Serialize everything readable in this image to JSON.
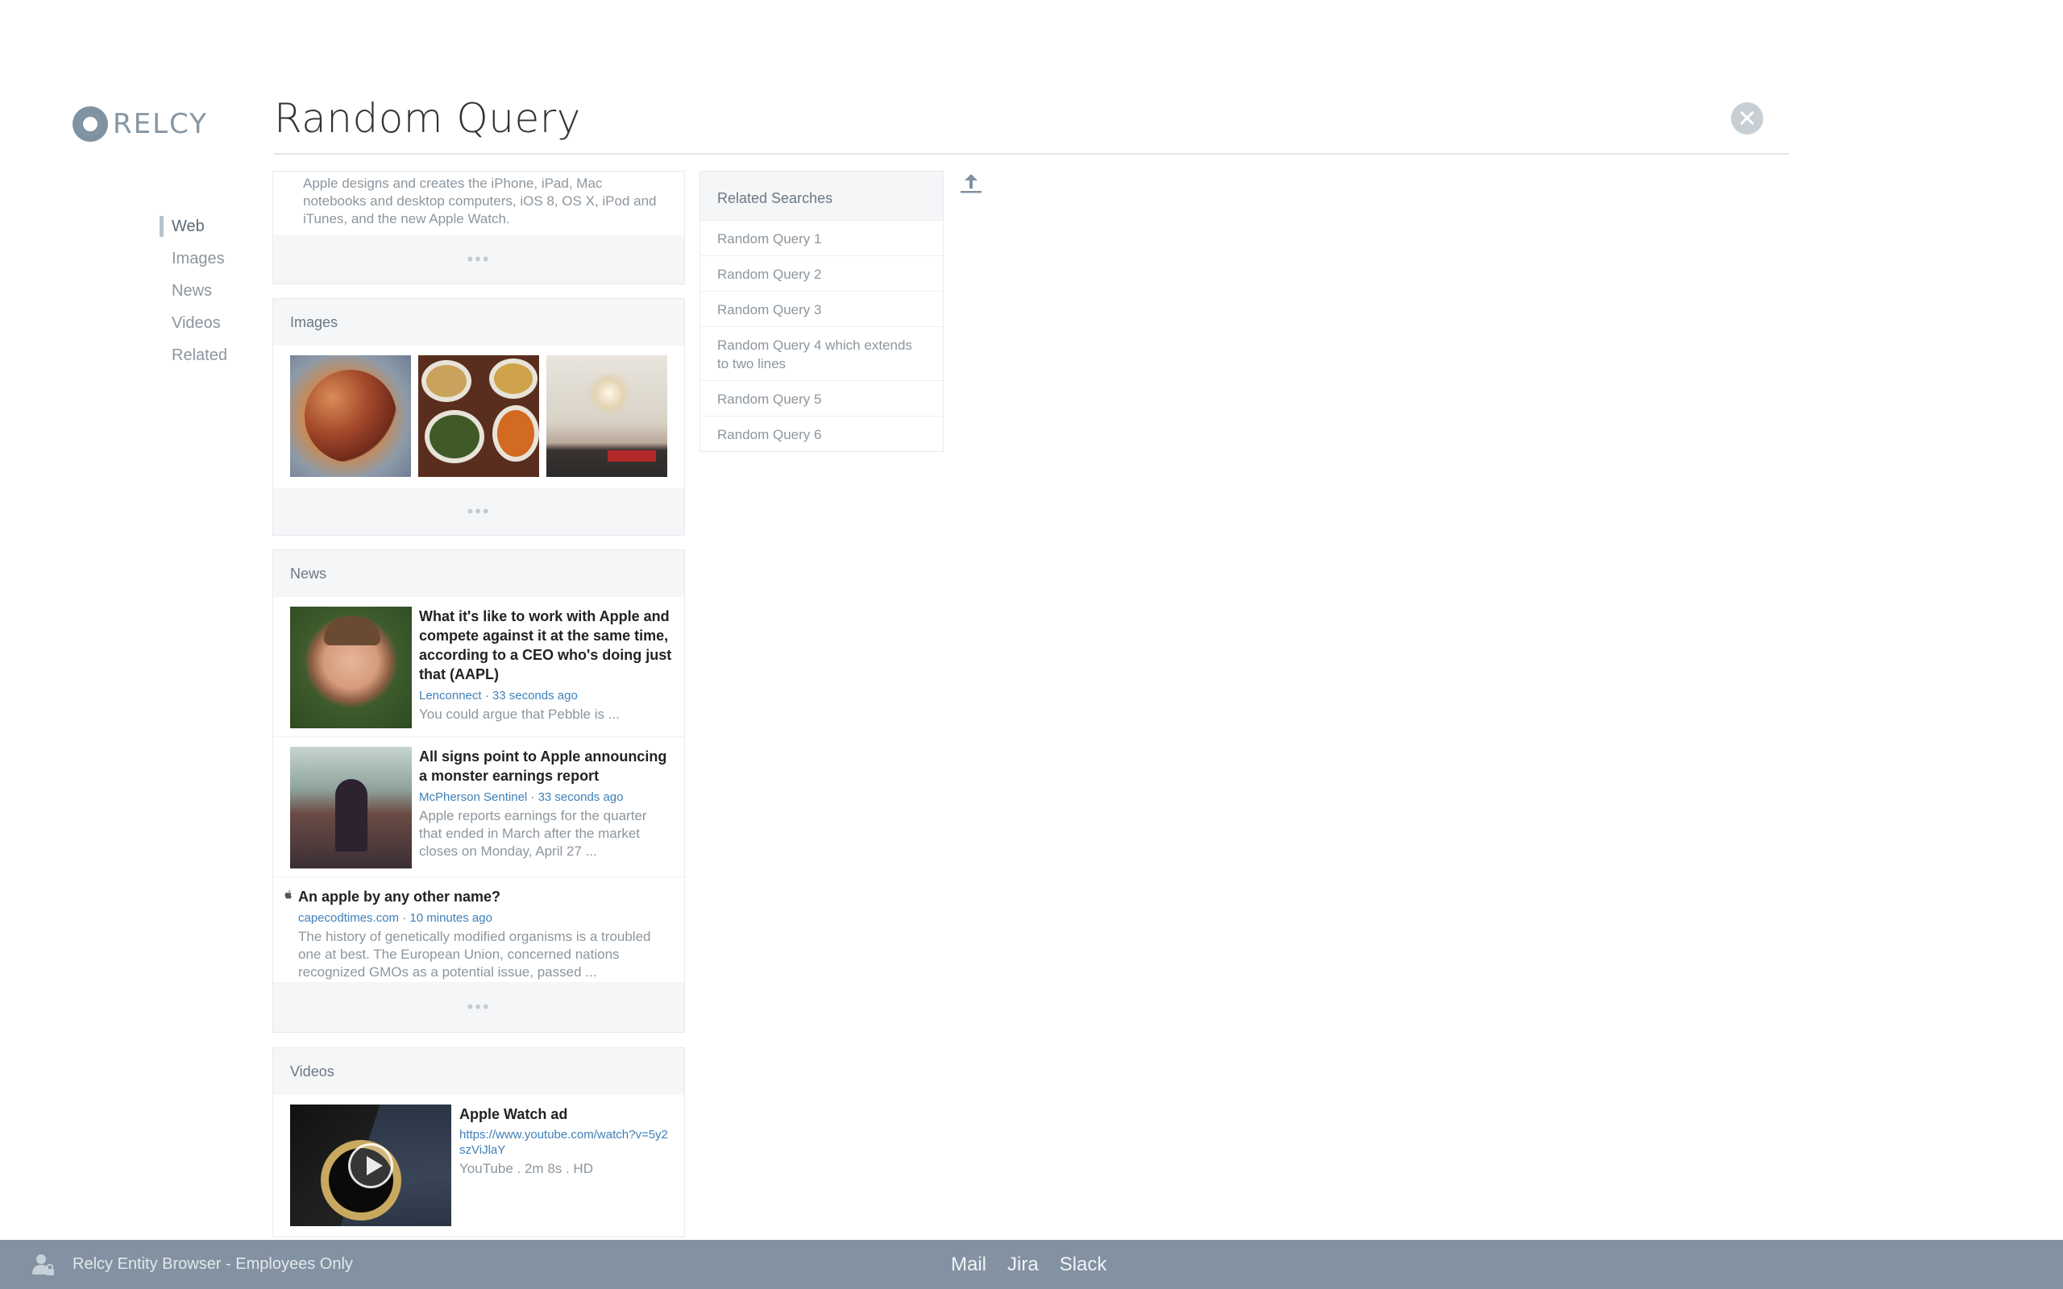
{
  "brand": {
    "logo_text": "RELCY"
  },
  "header": {
    "title": "Random Query"
  },
  "nav": {
    "items": [
      {
        "label": "Web",
        "active": true
      },
      {
        "label": "Images",
        "active": false
      },
      {
        "label": "News",
        "active": false
      },
      {
        "label": "Videos",
        "active": false
      },
      {
        "label": "Related",
        "active": false
      }
    ]
  },
  "web": {
    "snippet": "Apple designs and creates the iPhone, iPad, Mac notebooks and desktop computers, iOS 8, OS X, iPod and iTunes, and the new Apple Watch.",
    "more": "•••"
  },
  "images": {
    "heading": "Images",
    "thumbnails": [
      "food-dish-image",
      "indian-curry-bowls-image",
      "restaurant-hall-image"
    ],
    "more": "•••"
  },
  "news": {
    "heading": "News",
    "items": [
      {
        "title": "What it's like to work with Apple and compete against it at the same time, according to a CEO who's doing just that (AAPL)",
        "source": "Lenconnect · 33 seconds ago",
        "snippet": "You could argue that Pebble is ..."
      },
      {
        "title": "All signs point to Apple announcing a monster earnings report",
        "source": "McPherson Sentinel · 33 seconds ago",
        "snippet": "Apple reports earnings for the quarter that ended in March after the market closes on Monday, April 27 ..."
      },
      {
        "title": "An apple by any other name?",
        "source": "capecodtimes.com · 10 minutes ago",
        "snippet": "The history of genetically modified organisms is a troubled one at best. The European Union, concerned nations recognized GMOs as a potential issue, passed ..."
      }
    ],
    "more": "•••"
  },
  "videos": {
    "heading": "Videos",
    "items": [
      {
        "title": "Apple Watch ad",
        "url": "https://www.youtube.com/watch?v=5y2szViJlaY",
        "meta": "YouTube . 2m 8s . HD"
      }
    ]
  },
  "related": {
    "heading": "Related Searches",
    "items": [
      "Random Query 1",
      "Random Query 2",
      "Random Query 3",
      "Random Query 4 which extends to two lines",
      "Random Query 5",
      "Random Query 6"
    ]
  },
  "footer": {
    "label": "Relcy Entity Browser - Employees Only",
    "links": [
      "Mail",
      "Jira",
      "Slack"
    ]
  },
  "colors": {
    "accent_link": "#3f7fb8",
    "footer_bg": "#8292a2",
    "card_header_bg": "#f5f6f8"
  }
}
